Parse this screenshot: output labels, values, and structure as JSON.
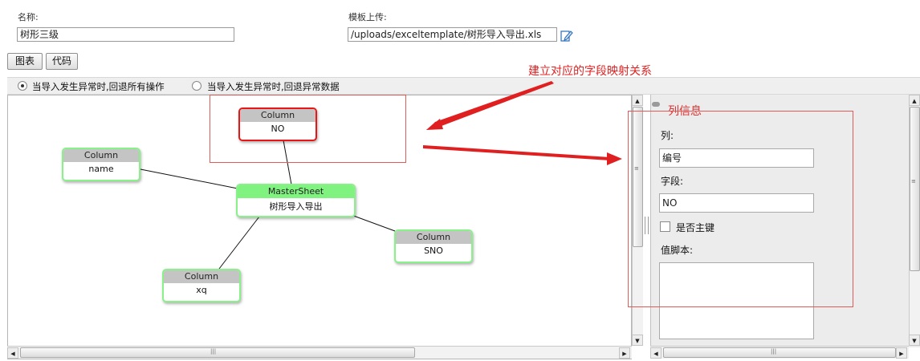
{
  "form": {
    "name_label": "名称:",
    "name_value": "树形三级",
    "upload_label": "模板上传:",
    "upload_value": "/uploads/exceltemplate/树形导入导出.xls"
  },
  "tabs": {
    "chart": "图表",
    "code": "代码"
  },
  "options": {
    "rollback_all": "当导入发生异常时,回退所有操作",
    "rollback_data": "当导入发生异常时,回退异常数据",
    "selected": "rollback_all"
  },
  "annotation": "建立对应的字段映射关系",
  "nodes": {
    "no": {
      "type": "Column",
      "label": "NO"
    },
    "name": {
      "type": "Column",
      "label": "name"
    },
    "master": {
      "type": "MasterSheet",
      "label": "树形导入导出"
    },
    "sno": {
      "type": "Column",
      "label": "SNO"
    },
    "xq": {
      "type": "Column",
      "label": "xq"
    }
  },
  "panel": {
    "title": "列信息",
    "col_label": "列:",
    "col_value": "编号",
    "field_label": "字段:",
    "field_value": "NO",
    "primary_key_label": "是否主键",
    "primary_key_checked": false,
    "script_label": "值脚本:",
    "script_value": ""
  },
  "colors": {
    "annotation": "#e02020",
    "node_border": "#8af08a",
    "selected_border": "#e81616",
    "master_header": "#7ff27f"
  }
}
